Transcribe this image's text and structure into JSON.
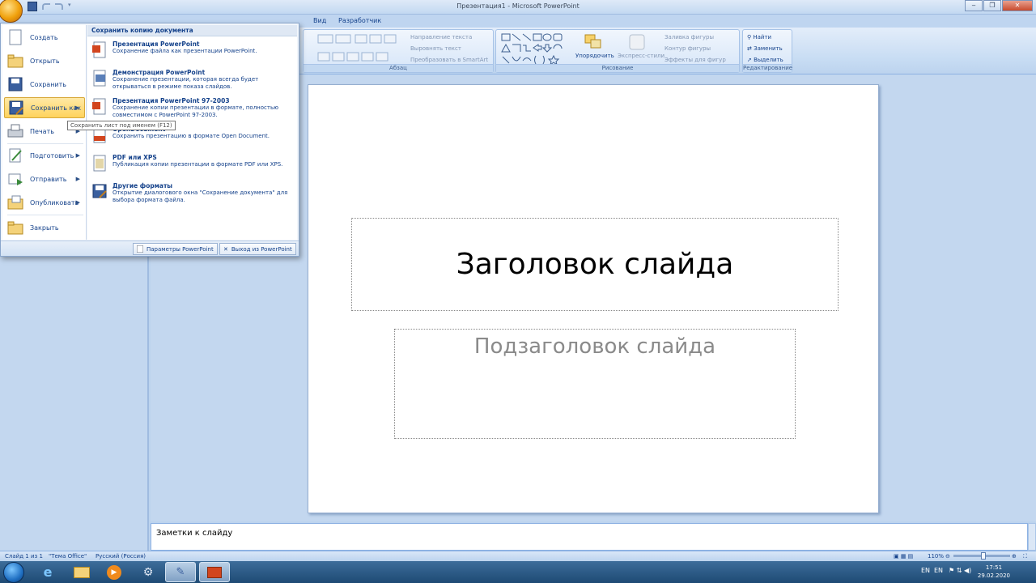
{
  "window": {
    "title": "Презентация1 - Microsoft PowerPoint",
    "controls": [
      "‒",
      "❐",
      "✕"
    ]
  },
  "tabs": [
    {
      "label": "Вид"
    },
    {
      "label": "Разработчик"
    }
  ],
  "ribbon": {
    "paragraph": {
      "label": "Абзац",
      "text_direction": "Направление текста",
      "align_text": "Выровнять текст",
      "smartart": "Преобразовать в SmartArt"
    },
    "drawing": {
      "label": "Рисование",
      "arrange": "Упорядочить",
      "quick_styles": "Экспресс-стили",
      "shape_fill": "Заливка фигуры",
      "shape_outline": "Контур фигуры",
      "shape_effects": "Эффекты для фигур"
    },
    "editing": {
      "label": "Редактирование",
      "find": "Найти",
      "replace": "Заменить",
      "select": "Выделить"
    }
  },
  "office_menu": {
    "left_items": [
      {
        "label": "Создать",
        "icon": "new-doc-icon",
        "has_arrow": false
      },
      {
        "label": "Открыть",
        "icon": "open-folder-icon",
        "has_arrow": false
      },
      {
        "label": "Сохранить",
        "icon": "save-icon",
        "has_arrow": false
      },
      {
        "label": "Сохранить как",
        "icon": "save-as-icon",
        "has_arrow": true
      },
      {
        "label": "Печать",
        "icon": "print-icon",
        "has_arrow": true
      },
      {
        "label": "Подготовить",
        "icon": "prepare-icon",
        "has_arrow": true
      },
      {
        "label": "Отправить",
        "icon": "send-icon",
        "has_arrow": true
      },
      {
        "label": "Опубликовать",
        "icon": "publish-icon",
        "has_arrow": true
      },
      {
        "label": "Закрыть",
        "icon": "close-doc-icon",
        "has_arrow": false
      }
    ],
    "right_header": "Сохранить копию документа",
    "right_items": [
      {
        "title": "Презентация PowerPoint",
        "desc": "Сохранение файла как презентации PowerPoint."
      },
      {
        "title": "Демонстрация PowerPoint",
        "desc": "Сохранение презентации, которая всегда будет открываться в режиме показа слайдов."
      },
      {
        "title": "Презентация PowerPoint 97-2003",
        "desc": "Сохранение копии презентации в формате, полностью совместимом с PowerPoint 97-2003."
      },
      {
        "title": "OpenDocument",
        "desc": "Сохранить презентацию в формате Open Document."
      },
      {
        "title": "PDF или XPS",
        "desc": "Публикация копии презентации в формате PDF или XPS."
      },
      {
        "title": "Другие форматы",
        "desc": "Открытие диалогового окна \"Сохранение документа\" для выбора формата файла."
      }
    ],
    "footer": {
      "options": "Параметры PowerPoint",
      "exit": "Выход из PowerPoint"
    },
    "tooltip": "Сохранить лист под именем (F12)"
  },
  "slide": {
    "title": "Заголовок слайда",
    "subtitle": "Подзаголовок слайда"
  },
  "notes": {
    "text": "Заметки к слайду"
  },
  "status": {
    "slide_counter": "Слайд 1 из 1",
    "theme": "\"Тема Office\"",
    "language": "Русский (Россия)",
    "zoom": "110%"
  },
  "taskbar": {
    "lang1": "EN",
    "lang2": "EN",
    "time": "17:51",
    "date": "29.02.2020"
  },
  "colors": {
    "accent": "#15428b",
    "highlight": "#ffd35c",
    "taskbar": "#1e4a74"
  }
}
